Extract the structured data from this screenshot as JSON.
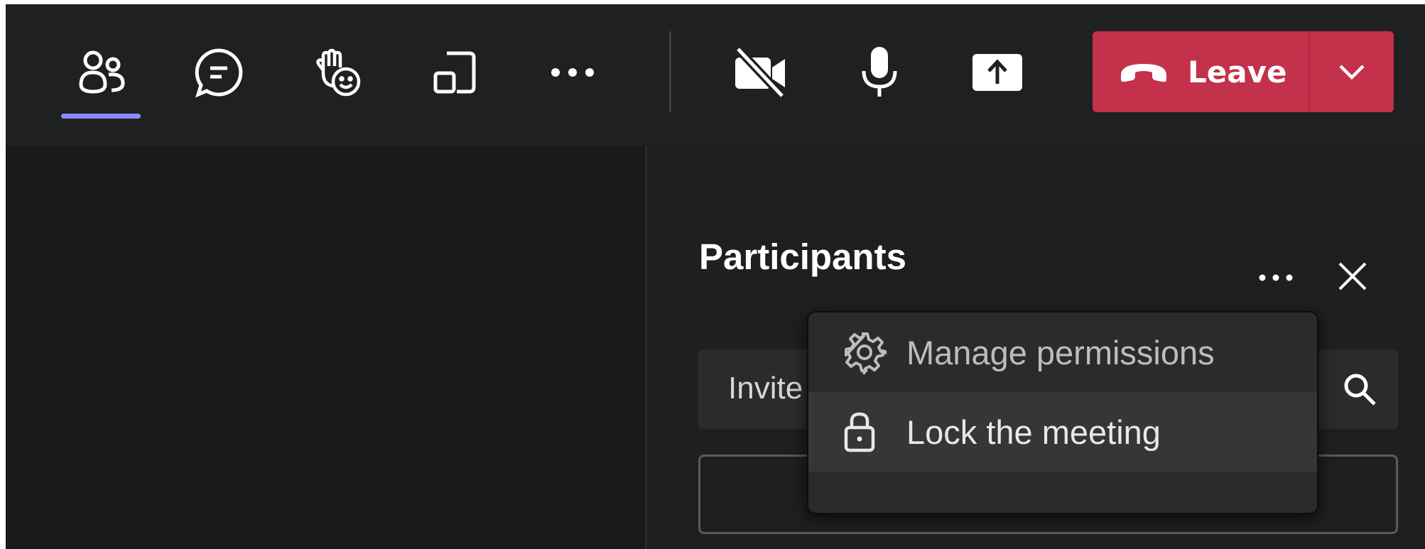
{
  "toolbar": {
    "buttons": [
      {
        "icon": "people-icon",
        "active": true
      },
      {
        "icon": "chat-icon"
      },
      {
        "icon": "react-raise-hand-icon"
      },
      {
        "icon": "share-view-icon"
      },
      {
        "icon": "more-actions-icon"
      },
      {
        "icon": "camera-off-icon"
      },
      {
        "icon": "microphone-icon"
      },
      {
        "icon": "share-screen-icon"
      }
    ],
    "active_indicator_color": "#8b8cff",
    "leave_label": "Leave",
    "leave_color": "#c4314b"
  },
  "panel": {
    "title": "Participants",
    "invite_placeholder": "Invite"
  },
  "menu": {
    "items": [
      {
        "label": "Manage permissions",
        "icon": "gear-icon"
      },
      {
        "label": "Lock the meeting",
        "icon": "lock-icon"
      }
    ]
  }
}
